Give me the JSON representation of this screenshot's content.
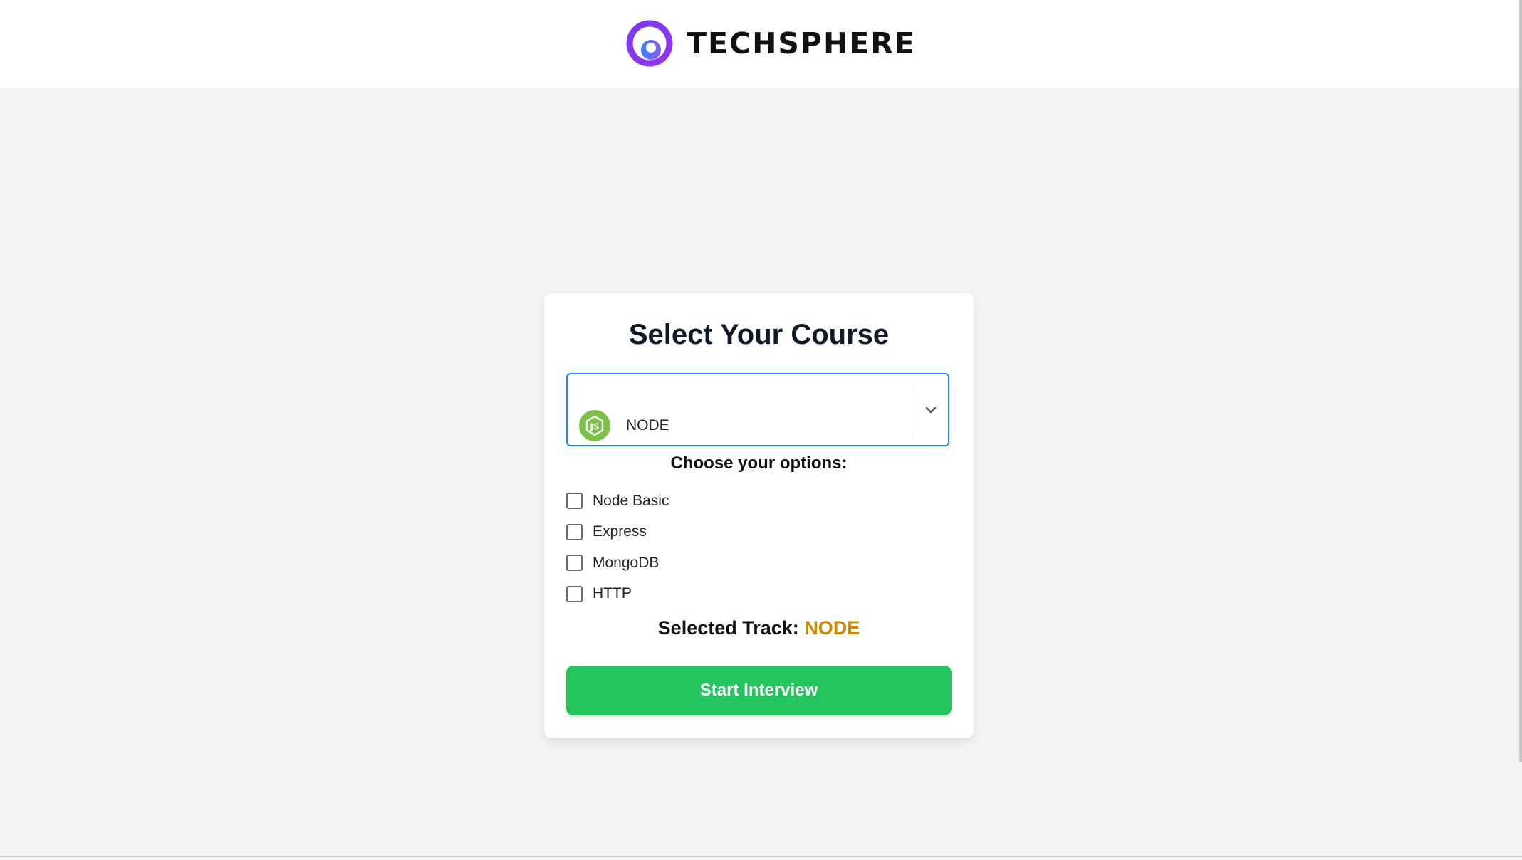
{
  "header": {
    "brand": "TECHSPHERE",
    "logo_icon": "techsphere-logo-icon",
    "brand_colors": [
      "#6d28d9",
      "#9333ea",
      "#3b82f6"
    ]
  },
  "card": {
    "title": "Select Your Course",
    "course_select": {
      "selected_value": "NODE",
      "selected_icon": "nodejs-icon",
      "dropdown_icon": "chevron-down-icon",
      "focus_color": "#2684ff"
    },
    "options_title": "Choose your options:",
    "options": [
      {
        "label": "Node Basic",
        "checked": false
      },
      {
        "label": "Express",
        "checked": false
      },
      {
        "label": "MongoDB",
        "checked": false
      },
      {
        "label": "HTTP",
        "checked": false
      }
    ],
    "selected_track": {
      "label": "Selected Track:",
      "value": "NODE",
      "value_color": "#ca8a04"
    },
    "start_button": {
      "label": "Start Interview",
      "color": "#22c55e"
    }
  }
}
